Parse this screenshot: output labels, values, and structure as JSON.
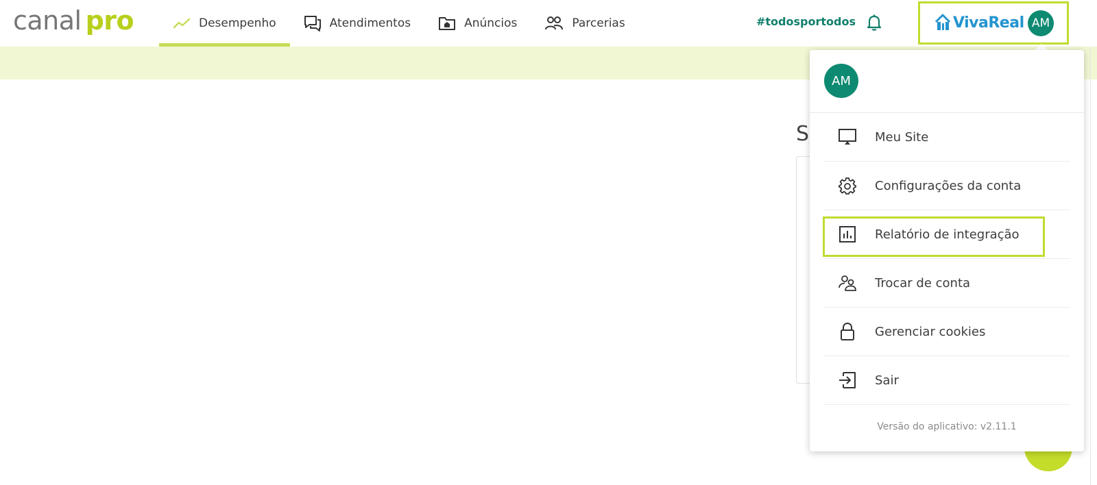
{
  "header": {
    "logo_part1": "canal",
    "logo_part2": "pro",
    "nav": [
      {
        "label": "Desempenho",
        "icon": "trending-up-icon",
        "active": true
      },
      {
        "label": "Atendimentos",
        "icon": "chat-bubbles-icon",
        "active": false
      },
      {
        "label": "Anúncios",
        "icon": "folder-home-icon",
        "active": false
      },
      {
        "label": "Parcerias",
        "icon": "users-icon",
        "active": false
      }
    ],
    "hashtag": "#todosportodos",
    "brand": "VivaReal",
    "avatar_initials": "AM"
  },
  "background": {
    "title_fragment": "S"
  },
  "dropdown": {
    "avatar_initials": "AM",
    "items": [
      {
        "label": "Meu Site",
        "icon": "monitor-icon"
      },
      {
        "label": "Configurações da conta",
        "icon": "gear-icon"
      },
      {
        "label": "Relatório de integração",
        "icon": "bar-chart-icon"
      },
      {
        "label": "Trocar de conta",
        "icon": "switch-users-icon"
      },
      {
        "label": "Gerenciar cookies",
        "icon": "lock-icon"
      },
      {
        "label": "Sair",
        "icon": "logout-icon"
      }
    ],
    "version": "Versão do aplicativo: v2.11.1"
  },
  "colors": {
    "accent_green": "#bfdc2e",
    "teal": "#0e8a72",
    "banner": "#f1f6d3",
    "brand_blue": "#2494cf"
  }
}
